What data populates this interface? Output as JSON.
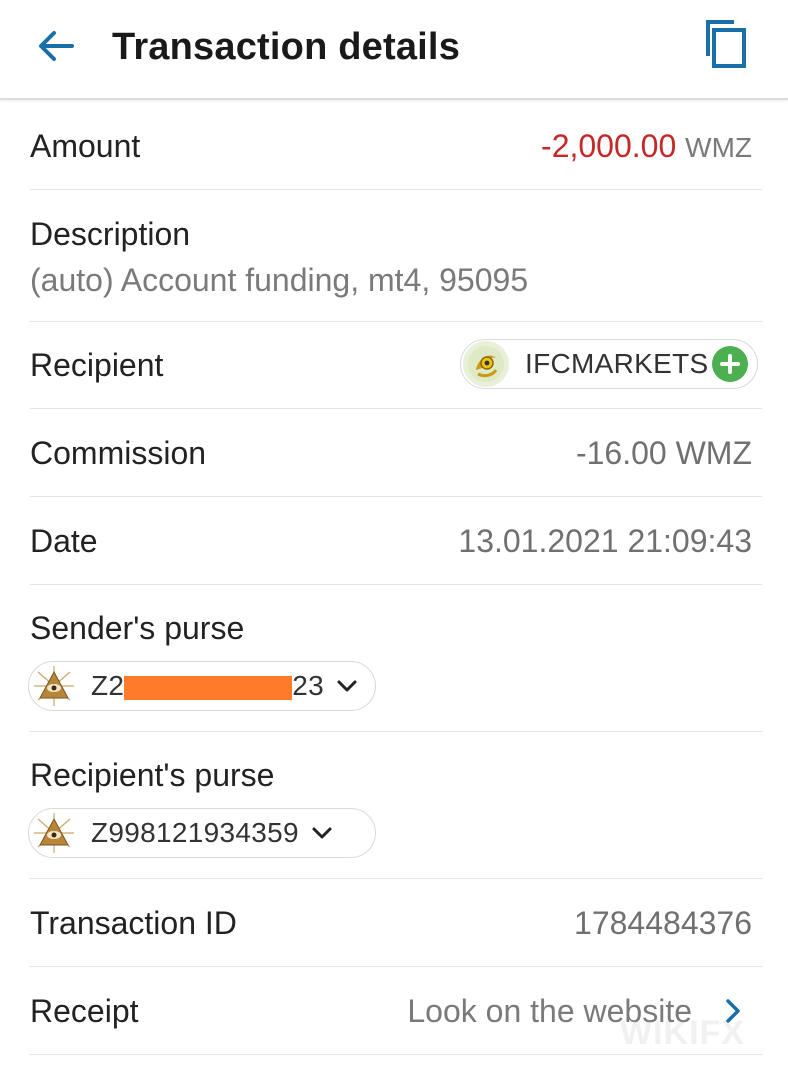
{
  "header": {
    "title": "Transaction details",
    "back_icon": "arrow-left-icon",
    "copy_icon": "copy-icon"
  },
  "rows": {
    "amount": {
      "label": "Amount",
      "value": "-2,000.00",
      "unit": "WMZ"
    },
    "description": {
      "label": "Description",
      "text": "(auto) Account funding, mt4, 95095"
    },
    "recipient": {
      "label": "Recipient",
      "name": "IFCMARKETS",
      "add_icon": "plus-circle-icon"
    },
    "commission": {
      "label": "Commission",
      "value": "-16.00 WMZ"
    },
    "date": {
      "label": "Date",
      "value": "13.01.2021 21:09:43"
    },
    "sender_purse": {
      "label": "Sender's purse",
      "prefix": "Z2",
      "suffix": "23"
    },
    "recipient_purse": {
      "label": "Recipient's purse",
      "value": "Z998121934359"
    },
    "transaction_id": {
      "label": "Transaction ID",
      "value": "1784484376"
    },
    "receipt": {
      "label": "Receipt",
      "value": "Look on the website"
    }
  },
  "colors": {
    "accent": "#1a6fa8",
    "negative": "#c62828",
    "add_green": "#4caf50",
    "redaction": "#ff7a2a"
  },
  "watermark": "WIKIFX"
}
